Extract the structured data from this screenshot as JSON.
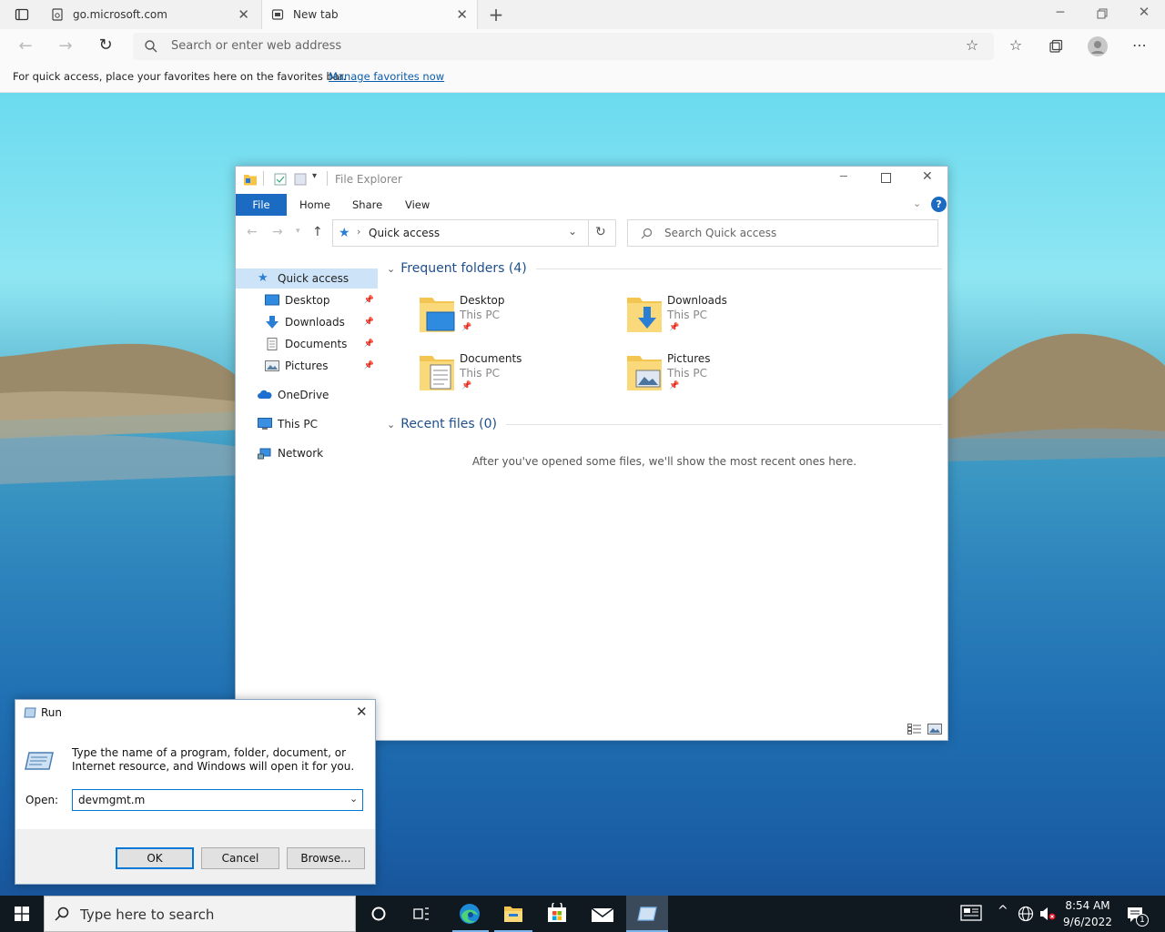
{
  "browser": {
    "tabs": [
      {
        "title": "go.microsoft.com",
        "active": false
      },
      {
        "title": "New tab",
        "active": true
      }
    ],
    "new_tab_icon": "plus-icon",
    "address_placeholder": "Search or enter web address",
    "favorites_bar": {
      "message": "For quick access, place your favorites here on the favorites bar.",
      "link": "Manage favorites now"
    }
  },
  "explorer": {
    "title": "File Explorer",
    "ribbon_tabs": [
      "File",
      "Home",
      "Share",
      "View"
    ],
    "address": "Quick access",
    "search_placeholder": "Search Quick access",
    "nav": {
      "quick_access": "Quick access",
      "desktop": "Desktop",
      "downloads": "Downloads",
      "documents": "Documents",
      "pictures": "Pictures",
      "onedrive": "OneDrive",
      "this_pc": "This PC",
      "network": "Network"
    },
    "frequent_header": "Frequent folders (4)",
    "folders": [
      {
        "name": "Desktop",
        "location": "This PC"
      },
      {
        "name": "Downloads",
        "location": "This PC"
      },
      {
        "name": "Documents",
        "location": "This PC"
      },
      {
        "name": "Pictures",
        "location": "This PC"
      }
    ],
    "recent_header": "Recent files (0)",
    "recent_empty": "After you've opened some files, we'll show the most recent ones here."
  },
  "run_dialog": {
    "title": "Run",
    "description": "Type the name of a program, folder, document, or Internet resource, and Windows will open it for you.",
    "open_label": "Open:",
    "open_value": "devmgmt.m",
    "ok": "OK",
    "cancel": "Cancel",
    "browse": "Browse..."
  },
  "taskbar": {
    "search_placeholder": "Type here to search",
    "time": "8:54 AM",
    "date": "9/6/2022",
    "notification_count": "1"
  },
  "colors": {
    "accent": "#0078d7",
    "ribbon_file": "#1a6bc1",
    "selection": "#cde3f7",
    "taskbar": "#101820"
  }
}
